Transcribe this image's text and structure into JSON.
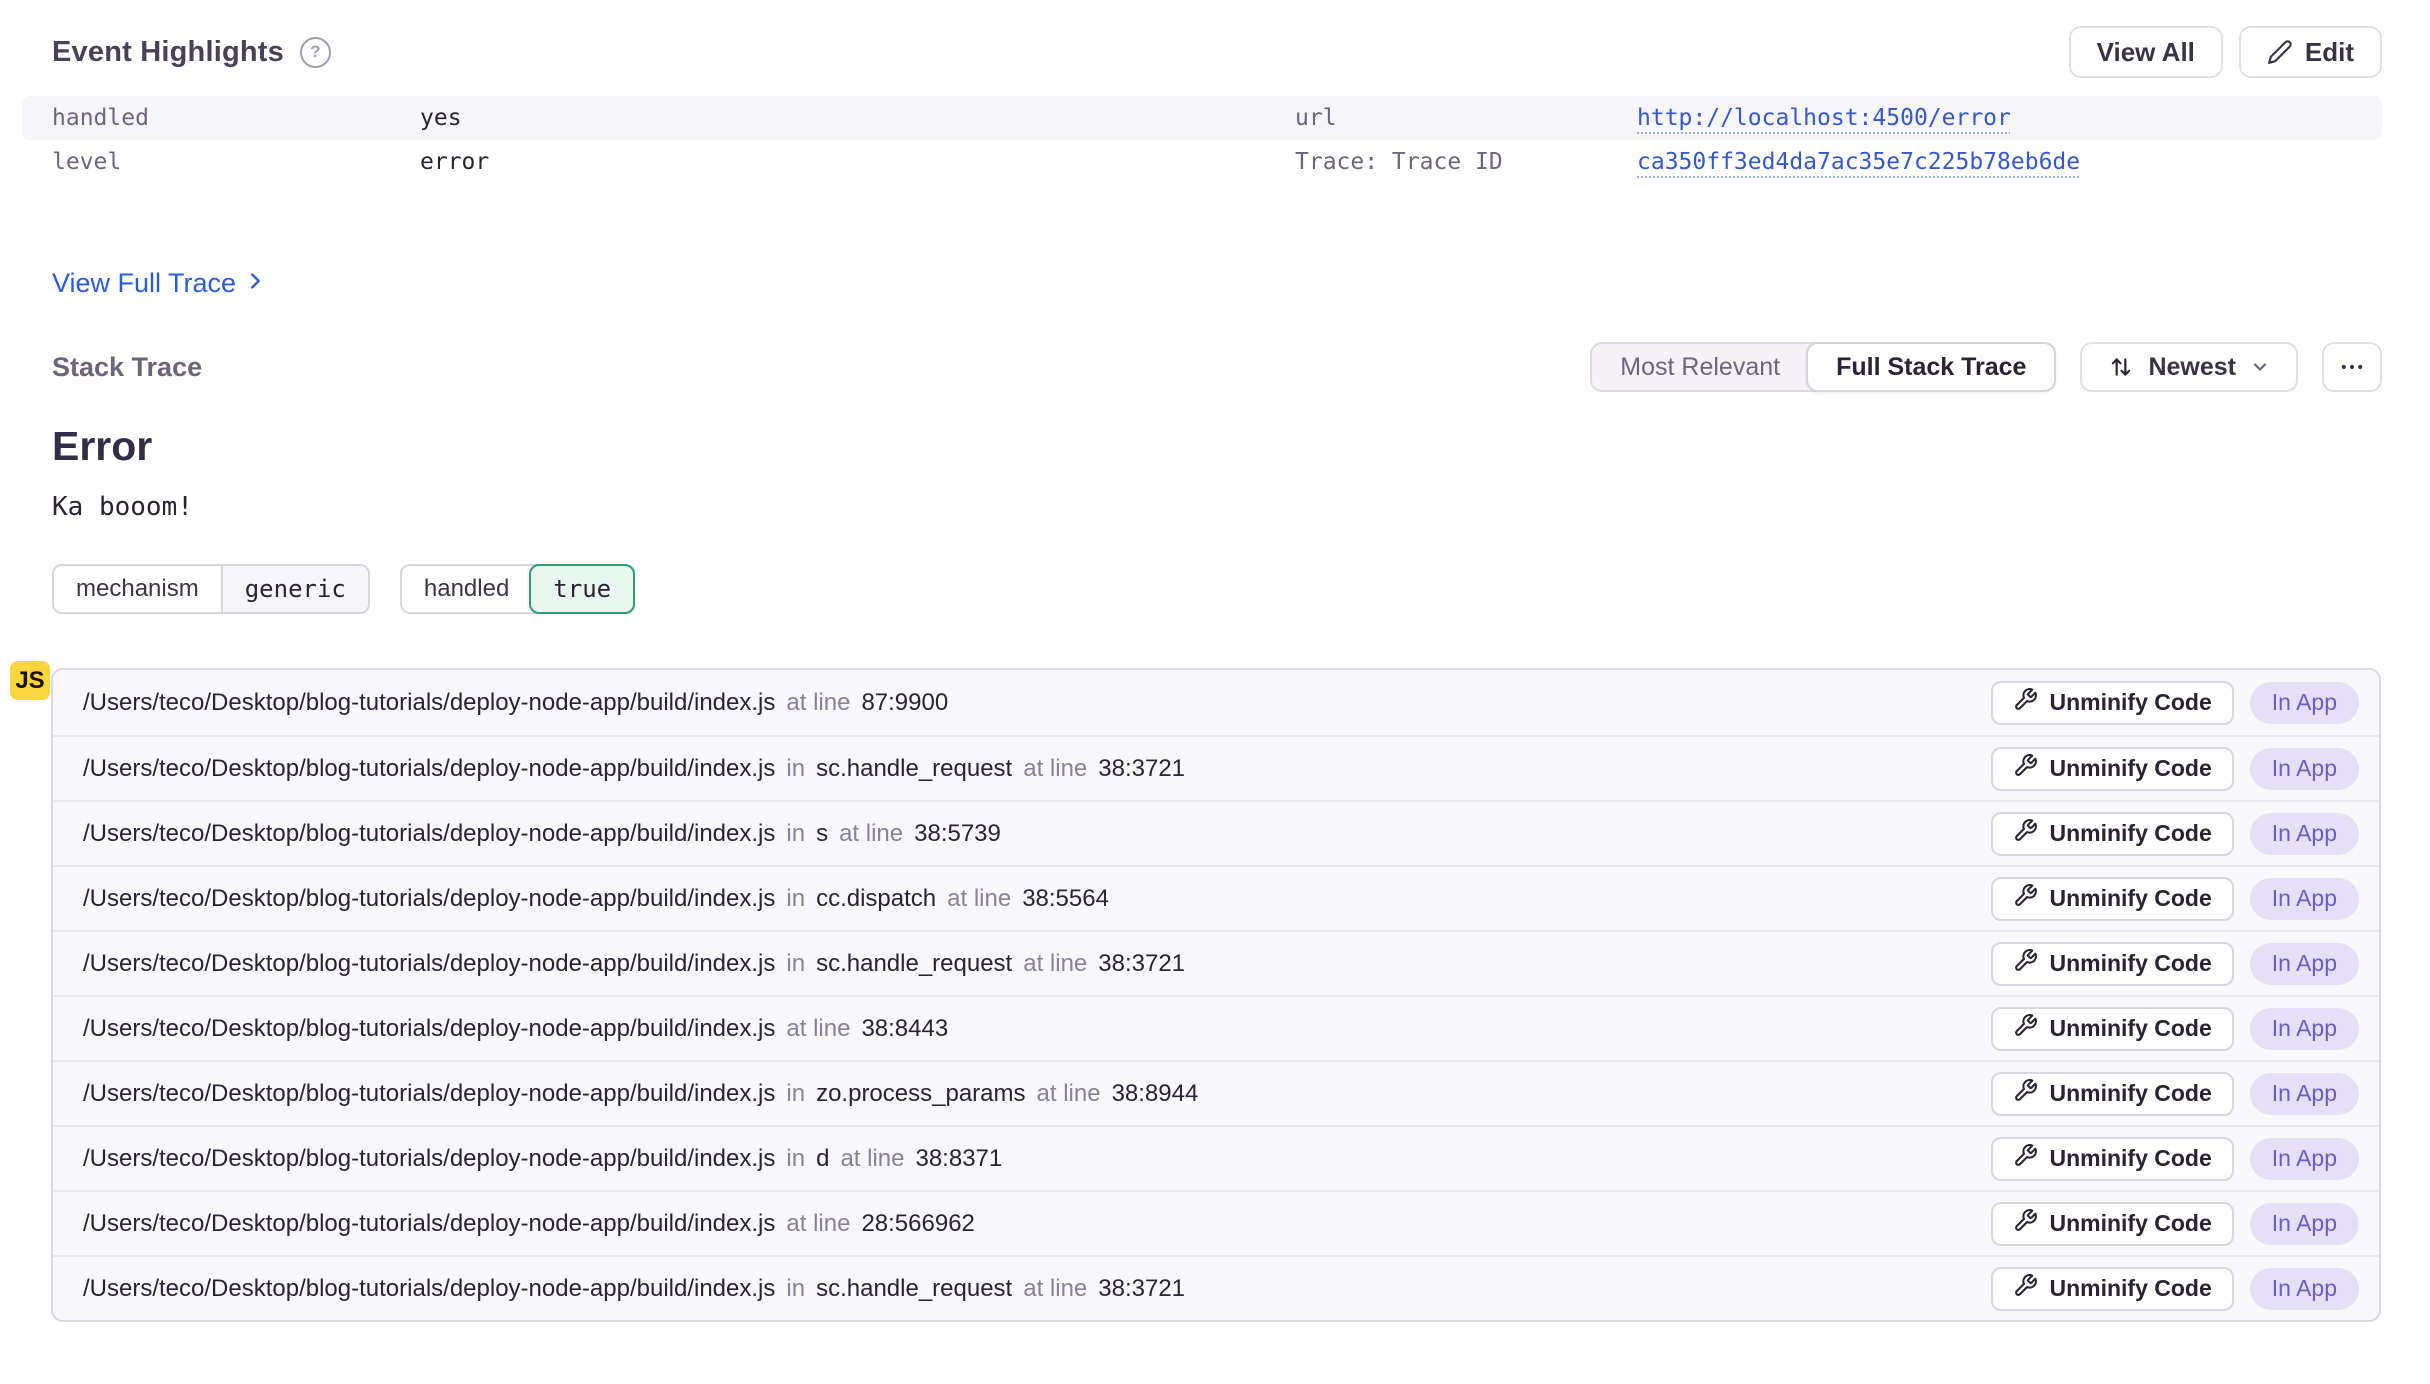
{
  "colors": {
    "link_blue": "#3558cf",
    "accent_blue": "#2c5cd4",
    "tag_green_border": "#2f9e72",
    "in_app_purple": "#695dc6",
    "in_app_bg": "#e6e0f6",
    "js_badge_yellow": "#fbd53d",
    "stripe_bg": "#f6f6f8",
    "frame_bg": "#f8f8fa"
  },
  "header": {
    "title": "Event Highlights",
    "help_icon": "question-mark-circle",
    "view_all_label": "View All",
    "edit_label": "Edit"
  },
  "highlights": {
    "handled_key": "handled",
    "handled_value": "yes",
    "level_key": "level",
    "level_value": "error",
    "url_key": "url",
    "url_value": "http://localhost:4500/error",
    "trace_key": "Trace: Trace ID",
    "trace_value": "ca350ff3ed4da7ac35e7c225b78eb6de"
  },
  "trace_link": {
    "label": "View Full Trace"
  },
  "stack_trace": {
    "heading": "Stack Trace",
    "toggle": {
      "options": [
        "Most Relevant",
        "Full Stack Trace"
      ],
      "selected": "Full Stack Trace"
    },
    "sort": {
      "label": "Newest"
    },
    "error_type": "Error",
    "error_message": "Ka booom!",
    "tags": [
      {
        "key": "mechanism",
        "value": "generic"
      },
      {
        "key": "handled",
        "value": "true"
      }
    ],
    "platform_badge": "JS",
    "labels": {
      "in_word": "in",
      "at_line": "at line",
      "unminify": "Unminify Code",
      "in_app": "In App"
    },
    "frames": [
      {
        "path": "/Users/teco/Desktop/blog-tutorials/deploy-node-app/build/index.js",
        "function": null,
        "line": "87:9900"
      },
      {
        "path": "/Users/teco/Desktop/blog-tutorials/deploy-node-app/build/index.js",
        "function": "sc.handle_request",
        "line": "38:3721"
      },
      {
        "path": "/Users/teco/Desktop/blog-tutorials/deploy-node-app/build/index.js",
        "function": "s",
        "line": "38:5739"
      },
      {
        "path": "/Users/teco/Desktop/blog-tutorials/deploy-node-app/build/index.js",
        "function": "cc.dispatch",
        "line": "38:5564"
      },
      {
        "path": "/Users/teco/Desktop/blog-tutorials/deploy-node-app/build/index.js",
        "function": "sc.handle_request",
        "line": "38:3721"
      },
      {
        "path": "/Users/teco/Desktop/blog-tutorials/deploy-node-app/build/index.js",
        "function": null,
        "line": "38:8443"
      },
      {
        "path": "/Users/teco/Desktop/blog-tutorials/deploy-node-app/build/index.js",
        "function": "zo.process_params",
        "line": "38:8944"
      },
      {
        "path": "/Users/teco/Desktop/blog-tutorials/deploy-node-app/build/index.js",
        "function": "d",
        "line": "38:8371"
      },
      {
        "path": "/Users/teco/Desktop/blog-tutorials/deploy-node-app/build/index.js",
        "function": null,
        "line": "28:566962"
      },
      {
        "path": "/Users/teco/Desktop/blog-tutorials/deploy-node-app/build/index.js",
        "function": "sc.handle_request",
        "line": "38:3721"
      }
    ]
  }
}
